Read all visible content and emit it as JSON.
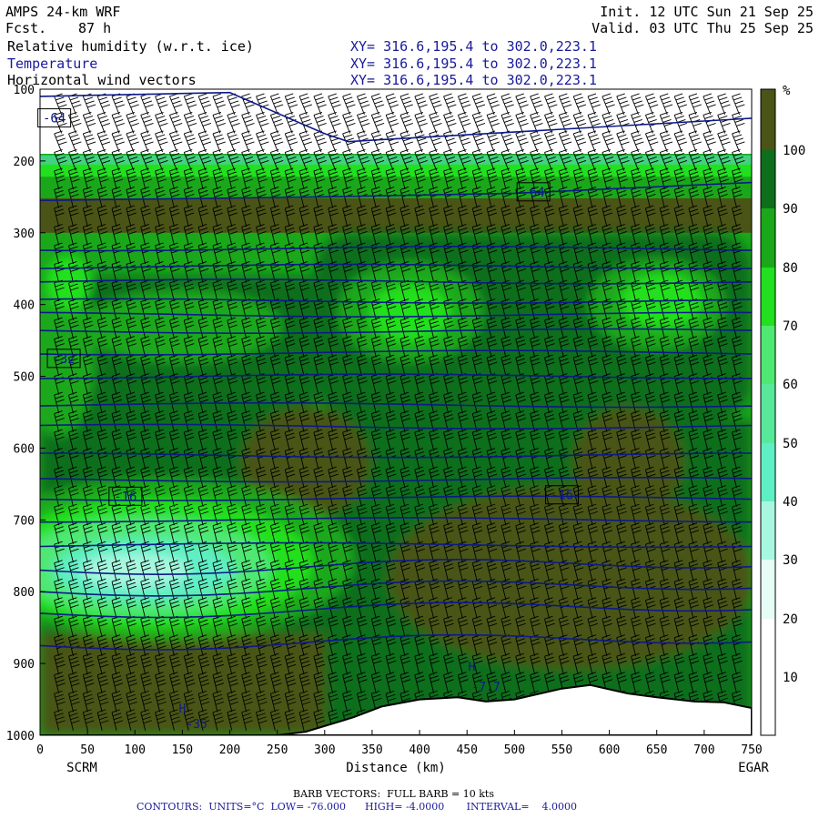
{
  "header": {
    "model": "AMPS 24-km WRF",
    "forecast_label": "Fcst.",
    "forecast_hours": "87 h",
    "init": "Init. 12 UTC Sun 21 Sep 25",
    "valid": "Valid. 03 UTC Thu 25 Sep 25",
    "field1": "Relative humidity (w.r.t. ice)",
    "field2": "Temperature",
    "field3": "Horizontal wind vectors",
    "xy1": "XY= 316.6,195.4 to 302.0,223.1",
    "xy2": "XY= 316.6,195.4 to 302.0,223.1",
    "xy3": "XY= 316.6,195.4 to 302.0,223.1"
  },
  "colors": {
    "rh_0_10": "#ffffff",
    "rh_10_20": "#ffffff",
    "rh_20_30": "#e6fdf5",
    "rh_30_40": "#a8f8e0",
    "rh_40_50": "#5fefc4",
    "rh_50_60": "#58e89a",
    "rh_60_70": "#4fe873",
    "rh_70_80": "#20e01f",
    "rh_80_90": "#1aa81a",
    "rh_90_100": "#0f6e1c",
    "rh_100_plus": "#4a5416",
    "temperature_contour": "#0c1a8a",
    "terrain": "#ffffff"
  },
  "chart_data": {
    "type": "heatmap",
    "title": "Relative humidity (w.r.t. ice)",
    "overlays": [
      "Temperature",
      "Horizontal wind vectors"
    ],
    "xlabel": "Distance (km)",
    "xlim": [
      0,
      750
    ],
    "x_ticks": [
      0,
      50,
      100,
      150,
      200,
      250,
      300,
      350,
      400,
      450,
      500,
      550,
      600,
      650,
      700,
      750
    ],
    "ylim": [
      1000,
      100
    ],
    "y_ticks": [
      100,
      200,
      300,
      400,
      500,
      600,
      700,
      800,
      900,
      1000
    ],
    "endpoints": {
      "left": "SCRM",
      "right": "EGAR"
    },
    "colorbar": {
      "unit": "%",
      "levels": [
        10,
        20,
        30,
        40,
        50,
        60,
        70,
        80,
        90,
        100
      ]
    },
    "temperature_labels": [
      {
        "text": "-64",
        "x": 15,
        "p": 140
      },
      {
        "text": "-64",
        "x": 520,
        "p": 243
      },
      {
        "text": "-32",
        "x": 25,
        "p": 475
      },
      {
        "text": "-16",
        "x": 90,
        "p": 667
      },
      {
        "text": "-16",
        "x": 550,
        "p": 665
      }
    ],
    "temperature_contour_levels_p_at_left": [
      110,
      322,
      347,
      368,
      395,
      414,
      437,
      467,
      500,
      540,
      570,
      610,
      644,
      670,
      700,
      735,
      770,
      800,
      830,
      875
    ],
    "terrain_pressure": [
      {
        "x": 0,
        "p": 1000
      },
      {
        "x": 250,
        "p": 1000
      },
      {
        "x": 280,
        "p": 995
      },
      {
        "x": 330,
        "p": 975
      },
      {
        "x": 360,
        "p": 960
      },
      {
        "x": 400,
        "p": 950
      },
      {
        "x": 440,
        "p": 947
      },
      {
        "x": 470,
        "p": 953
      },
      {
        "x": 500,
        "p": 950
      },
      {
        "x": 550,
        "p": 935
      },
      {
        "x": 580,
        "p": 930
      },
      {
        "x": 620,
        "p": 942
      },
      {
        "x": 650,
        "p": 947
      },
      {
        "x": 690,
        "p": 953
      },
      {
        "x": 720,
        "p": 954
      },
      {
        "x": 750,
        "p": 962
      }
    ],
    "extra_labels": [
      {
        "text": "H",
        "x": 150,
        "p": 968
      },
      {
        "text": "-35",
        "x": 165,
        "p": 990
      },
      {
        "text": "H",
        "x": 455,
        "p": 910
      },
      {
        "text": "-7.7",
        "x": 470,
        "p": 938
      }
    ]
  },
  "footer": {
    "barb": "BARB VECTORS:  FULL BARB = 10 kts",
    "contours": "CONTOURS:  UNITS=°C  LOW= -76.000      HIGH= -4.0000       INTERVAL=    4.0000"
  }
}
